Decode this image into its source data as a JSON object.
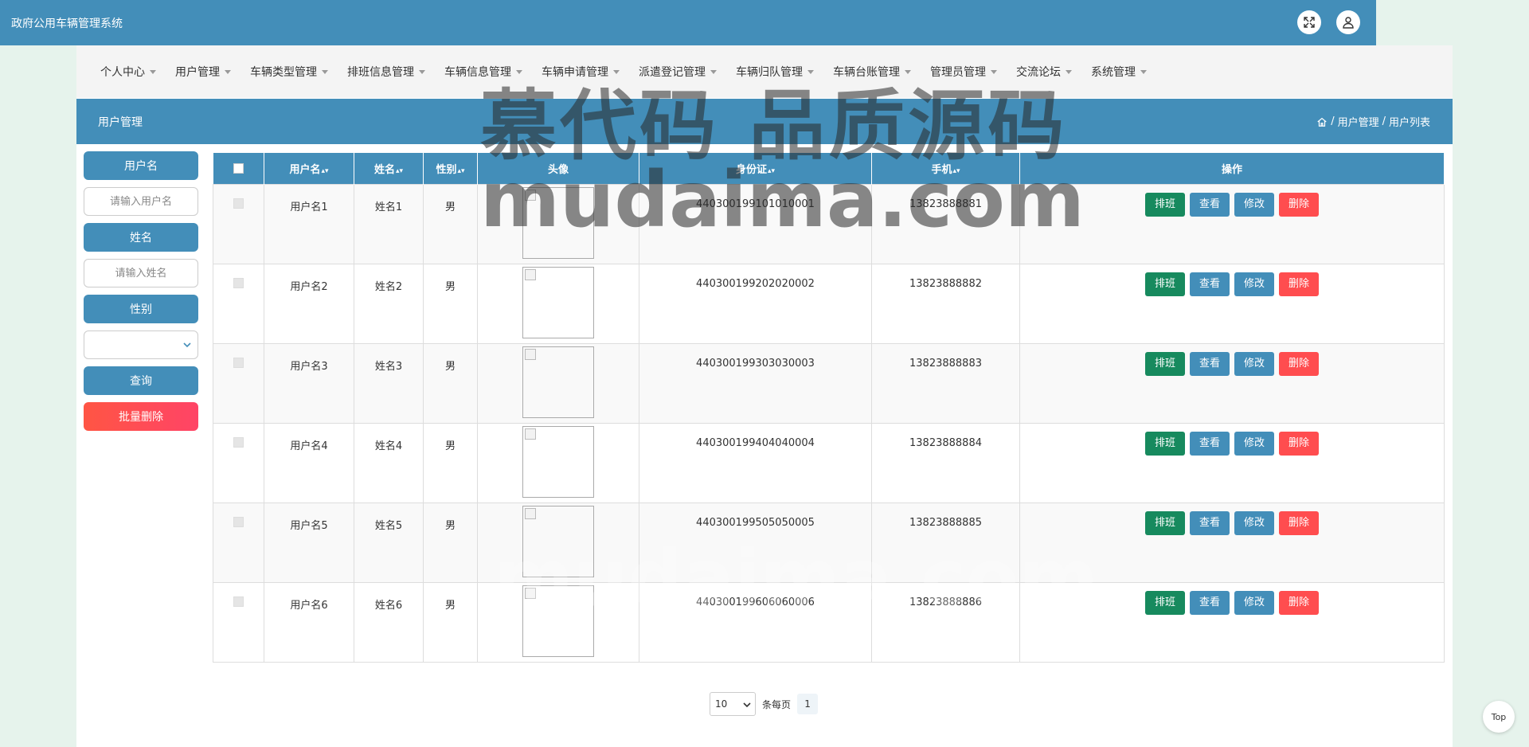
{
  "header": {
    "app_title": "政府公用车辆管理系统",
    "icons": [
      "fullscreen-icon",
      "user-icon"
    ]
  },
  "nav": [
    {
      "label": "个人中心"
    },
    {
      "label": "用户管理"
    },
    {
      "label": "车辆类型管理"
    },
    {
      "label": "排班信息管理"
    },
    {
      "label": "车辆信息管理"
    },
    {
      "label": "车辆申请管理"
    },
    {
      "label": "派遣登记管理"
    },
    {
      "label": "车辆归队管理"
    },
    {
      "label": "车辆台账管理"
    },
    {
      "label": "管理员管理"
    },
    {
      "label": "交流论坛"
    },
    {
      "label": "系统管理"
    }
  ],
  "section": {
    "title": "用户管理",
    "breadcrumb": [
      "用户管理",
      "用户列表"
    ]
  },
  "search": {
    "username_label": "用户名",
    "username_placeholder": "请输入用户名",
    "name_label": "姓名",
    "name_placeholder": "请输入姓名",
    "gender_label": "性别",
    "gender_value": "",
    "query_label": "查询",
    "batch_delete_label": "批量删除"
  },
  "table": {
    "columns": [
      "用户名",
      "姓名",
      "性别",
      "头像",
      "身份证",
      "手机",
      "操作"
    ],
    "rows": [
      {
        "username": "用户名1",
        "name": "姓名1",
        "gender": "男",
        "idcard": "440300199101010001",
        "phone": "13823888881"
      },
      {
        "username": "用户名2",
        "name": "姓名2",
        "gender": "男",
        "idcard": "440300199202020002",
        "phone": "13823888882"
      },
      {
        "username": "用户名3",
        "name": "姓名3",
        "gender": "男",
        "idcard": "440300199303030003",
        "phone": "13823888883"
      },
      {
        "username": "用户名4",
        "name": "姓名4",
        "gender": "男",
        "idcard": "440300199404040004",
        "phone": "13823888884"
      },
      {
        "username": "用户名5",
        "name": "姓名5",
        "gender": "男",
        "idcard": "440300199505050005",
        "phone": "13823888885"
      },
      {
        "username": "用户名6",
        "name": "姓名6",
        "gender": "男",
        "idcard": "440300199606060006",
        "phone": "13823888886"
      }
    ],
    "actions": {
      "schedule": "排班",
      "view": "查看",
      "edit": "修改",
      "delete": "删除"
    }
  },
  "pagination": {
    "page_size": "10",
    "per_page_label": "条每页",
    "current_page": "1"
  },
  "top_button": "Top",
  "watermark": {
    "line1": "慕代码 品质源码",
    "line2": "mudaima.com"
  },
  "colors": {
    "primary": "#438eb9",
    "danger": "#ff4d4f",
    "success": "#178a5e"
  }
}
